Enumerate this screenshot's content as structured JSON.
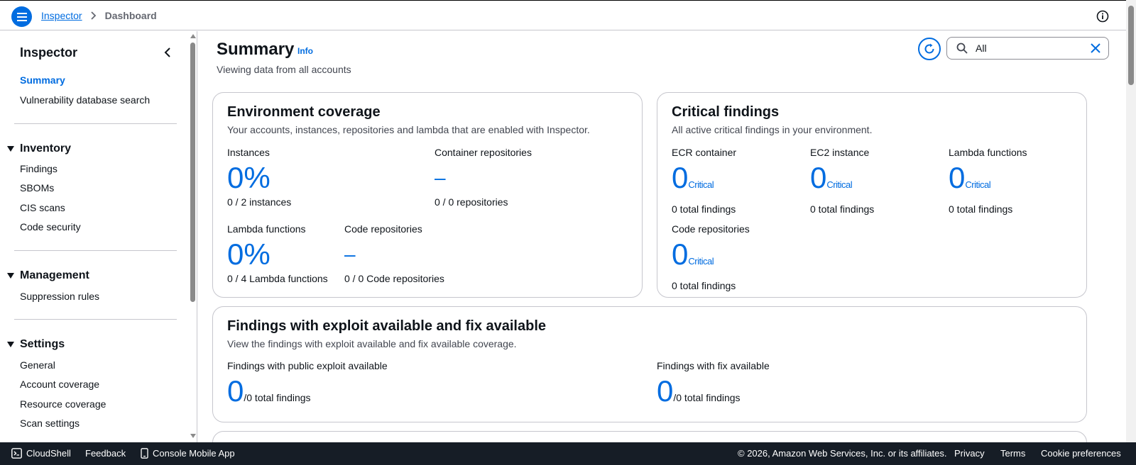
{
  "breadcrumb": {
    "root": "Inspector",
    "current": "Dashboard"
  },
  "sidebar": {
    "title": "Inspector",
    "top_links": [
      "Summary",
      "Vulnerability database search"
    ],
    "sections": [
      {
        "label": "Inventory",
        "items": [
          "Findings",
          "SBOMs",
          "CIS scans",
          "Code security"
        ]
      },
      {
        "label": "Management",
        "items": [
          "Suppression rules"
        ]
      },
      {
        "label": "Settings",
        "items": [
          "General",
          "Account coverage",
          "Resource coverage",
          "Scan settings"
        ]
      }
    ]
  },
  "header": {
    "title": "Summary",
    "info": "Info",
    "subtitle": "Viewing data from all accounts"
  },
  "search": {
    "value": "All"
  },
  "env_coverage": {
    "title": "Environment coverage",
    "desc": "Your accounts, instances, repositories and lambda that are enabled with Inspector.",
    "instances": {
      "label": "Instances",
      "value": "0%",
      "foot": "0 / 2 instances"
    },
    "container": {
      "label": "Container repositories",
      "value": "–",
      "foot": "0 / 0 repositories"
    },
    "lambda": {
      "label": "Lambda functions",
      "value": "0%",
      "foot": "0 / 4 Lambda functions"
    },
    "code": {
      "label": "Code repositories",
      "value": "–",
      "foot": "0 / 0 Code repositories"
    }
  },
  "critical": {
    "title": "Critical findings",
    "desc": "All active critical findings in your environment.",
    "sub": "Critical",
    "ecr": {
      "label": "ECR container",
      "value": "0",
      "foot": "0 total findings"
    },
    "ec2": {
      "label": "EC2 instance",
      "value": "0",
      "foot": "0 total findings"
    },
    "lambda": {
      "label": "Lambda functions",
      "value": "0",
      "foot": "0 total findings"
    },
    "code": {
      "label": "Code repositories",
      "value": "0",
      "foot": "0 total findings"
    }
  },
  "exploit": {
    "title": "Findings with exploit available and fix available",
    "desc": "View the findings with exploit available and fix available coverage.",
    "public": {
      "label": "Findings with public exploit available",
      "value": "0",
      "total": "/0 total findings"
    },
    "fix": {
      "label": "Findings with fix available",
      "value": "0",
      "total": "/0 total findings"
    }
  },
  "footer": {
    "cloudshell": "CloudShell",
    "feedback": "Feedback",
    "mobile": "Console Mobile App",
    "copyright": "© 2026, Amazon Web Services, Inc. or its affiliates.",
    "privacy": "Privacy",
    "terms": "Terms",
    "cookies": "Cookie preferences"
  },
  "colors": {
    "accent": "#006ce0",
    "footer_bg": "#161d26",
    "border": "#c6c6cd"
  },
  "icons": [
    "menu-icon",
    "chevron-right-icon",
    "info-circle-icon",
    "chevron-left-icon",
    "refresh-icon",
    "search-icon",
    "close-icon",
    "terminal-icon",
    "mobile-icon"
  ]
}
